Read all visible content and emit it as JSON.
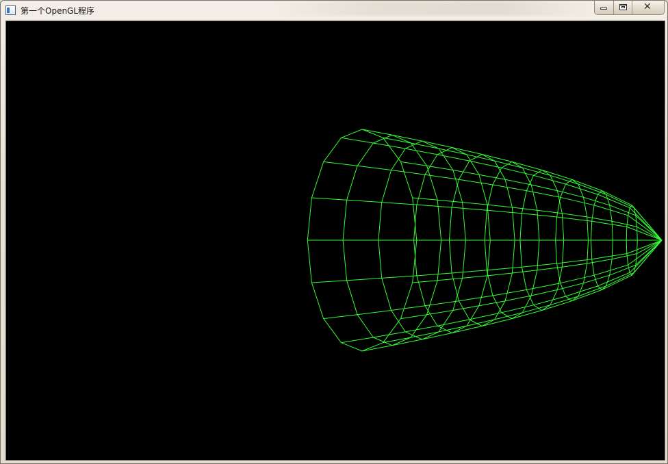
{
  "window": {
    "title": "第一个OpenGL程序",
    "icon": "application-window-icon",
    "controls": [
      "minimize-icon",
      "maximize-icon",
      "close-icon"
    ]
  },
  "scene": {
    "background_color": "#000000",
    "wire_color": "#33ff33",
    "shape": "wireframe paraboloid viewed from the side",
    "rings": 10,
    "spokes": 16
  }
}
